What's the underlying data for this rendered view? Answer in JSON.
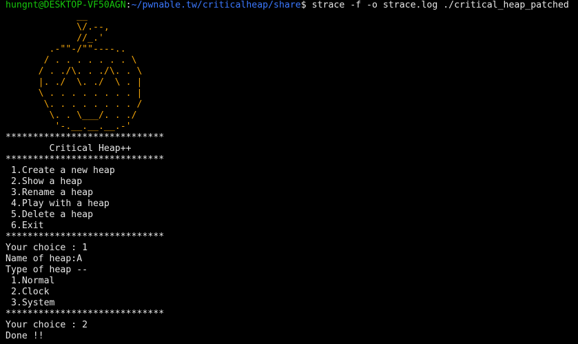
{
  "prompt": {
    "user_host": "hungnt@DESKTOP-VF50AGN",
    "separator": ":",
    "path": "~/pwnable.tw/criticalheap/share",
    "dollar": "$",
    "command": " strace -f -o strace.log ./critical_heap_patched"
  },
  "ascii_art": [
    "             __",
    "             \\/.--,",
    "             //_.'",
    "        .-\"\"-/\"\"----..",
    "       / . . . . . . . \\",
    "      / . ./\\. . ./\\. . \\",
    "      |. ./  \\. ./  \\ . |",
    "      \\ . . . . . . . . |",
    "       \\. . . . . . . . /",
    "        \\. . \\___/. . ./",
    "         '-.__.__.__.-'"
  ],
  "menu": {
    "border": "*****************************",
    "title": "        Critical Heap++",
    "options": [
      " 1.Create a new heap",
      " 2.Show a heap",
      " 3.Rename a heap",
      " 4.Play with a heap",
      " 5.Delete a heap",
      " 6.Exit"
    ]
  },
  "session": {
    "choice1": "Your choice : 1",
    "name_prompt": "Name of heap:A",
    "type_prompt": "Type of heap --",
    "types": [
      " 1.Normal",
      " 2.Clock",
      " 3.System"
    ],
    "choice2": "Your choice : 2",
    "result": "Done !!"
  },
  "colors": {
    "background": "#000000",
    "text": "#e6e6e6",
    "prompt_user": "#16c60c",
    "prompt_path": "#3b78ff",
    "art": "#f0a30a"
  }
}
